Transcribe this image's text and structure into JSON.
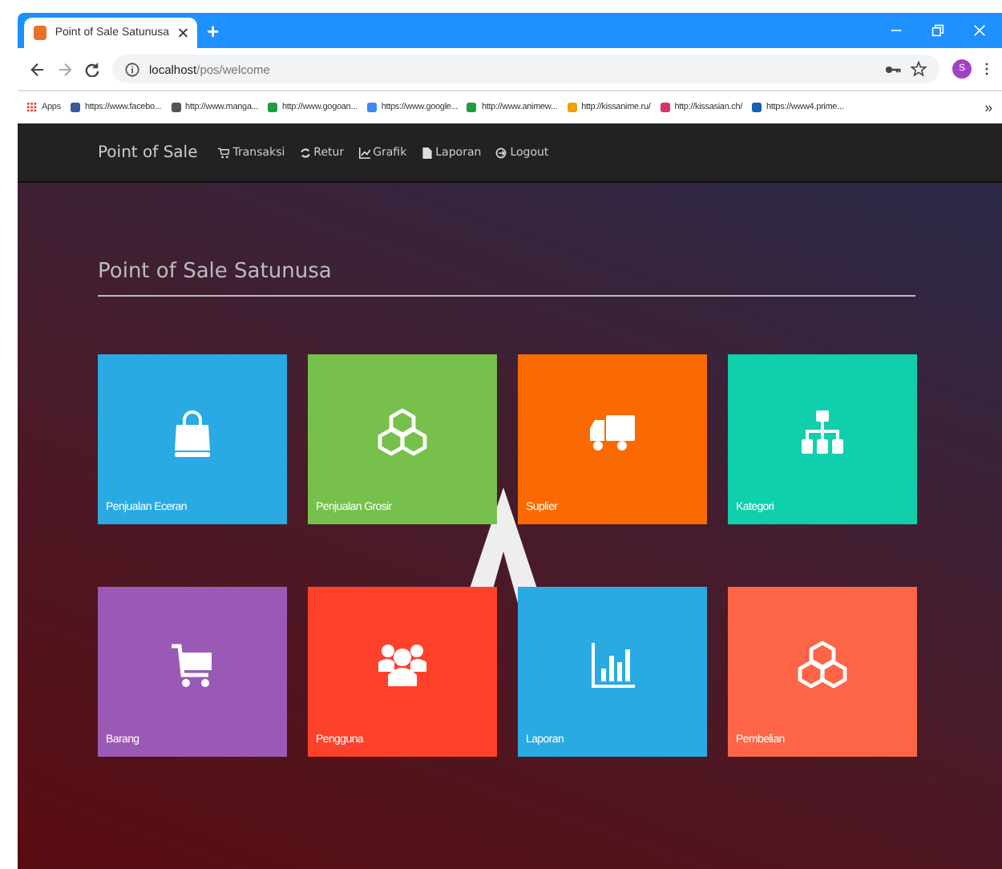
{
  "browser": {
    "tab_title": "Point of Sale Satunusa",
    "new_tab": "+",
    "url_host": "localhost",
    "url_path": "/pos/welcome",
    "profile": "S",
    "bookmarks": [
      {
        "label": "Apps",
        "color": "#e94235"
      },
      {
        "label": "https://www.facebo...",
        "color": "#3b5998"
      },
      {
        "label": "http://www.manga...",
        "color": "#555555"
      },
      {
        "label": "http://www.gogoan...",
        "color": "#1e9e3e"
      },
      {
        "label": "https://www.google...",
        "color": "#4285f4"
      },
      {
        "label": "http://www.animew...",
        "color": "#1e9e3e"
      },
      {
        "label": "http://kissanime.ru/",
        "color": "#f4a100"
      },
      {
        "label": "http://kissasian.ch/",
        "color": "#d6336c"
      },
      {
        "label": "https://www4.prime...",
        "color": "#1a5fb4"
      }
    ],
    "more": "»"
  },
  "navbar": {
    "brand": "Point of Sale",
    "items": [
      {
        "label": "Transaksi",
        "kind": "cart"
      },
      {
        "label": "Retur",
        "kind": "refresh"
      },
      {
        "label": "Grafik",
        "kind": "chart"
      },
      {
        "label": "Laporan",
        "kind": "file"
      },
      {
        "label": "Logout",
        "kind": "logout"
      }
    ]
  },
  "heading": "Point of Sale Satunusa",
  "tiles": [
    {
      "label": "Penjualan Eceran",
      "kind": "bag",
      "color": "#29aae2"
    },
    {
      "label": "Penjualan Grosir",
      "kind": "cubes",
      "color": "#77c04b"
    },
    {
      "label": "Suplier",
      "kind": "truck",
      "color": "#fb6a00"
    },
    {
      "label": "Kategori",
      "kind": "sitemap",
      "color": "#10cfac"
    },
    {
      "label": "Barang",
      "kind": "cart",
      "color": "#9b59b6"
    },
    {
      "label": "Pengguna",
      "kind": "users",
      "color": "#fe412b"
    },
    {
      "label": "Laporan",
      "kind": "chart",
      "color": "#29aae2"
    },
    {
      "label": "Pembelian",
      "kind": "cubes",
      "color": "#fd6546"
    }
  ]
}
